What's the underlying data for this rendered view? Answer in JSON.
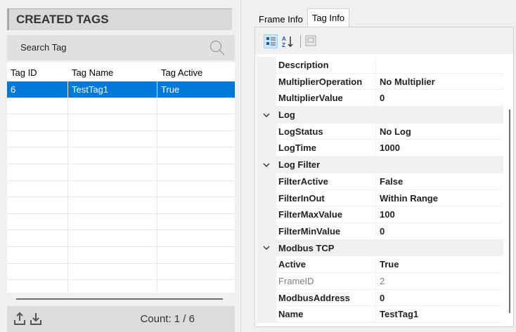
{
  "left": {
    "title": "CREATED TAGS",
    "search_placeholder": "Search Tag",
    "columns": [
      "Tag ID",
      "Tag Name",
      "Tag Active"
    ],
    "rows": [
      [
        "6",
        "TestTag1",
        "True"
      ],
      [
        "",
        "",
        ""
      ],
      [
        "",
        "",
        ""
      ],
      [
        "",
        "",
        ""
      ],
      [
        "",
        "",
        ""
      ],
      [
        "",
        "",
        ""
      ],
      [
        "",
        "",
        ""
      ],
      [
        "",
        "",
        ""
      ],
      [
        "",
        "",
        ""
      ],
      [
        "",
        "",
        ""
      ],
      [
        "",
        "",
        ""
      ],
      [
        "",
        "",
        ""
      ],
      [
        "",
        "",
        ""
      ]
    ],
    "count": "Count: 1 / 6",
    "icons": [
      "upload-icon",
      "download-icon",
      "search-icon"
    ]
  },
  "right": {
    "tabs": [
      "Frame Info",
      "Tag Info"
    ],
    "active_tab": "Tag Info",
    "toolbar": [
      "categorized-icon",
      "alphabetical-sort-icon",
      "property-pages-icon"
    ],
    "properties": [
      {
        "type": "prop",
        "name": "Description",
        "value": ""
      },
      {
        "type": "prop",
        "name": "MultiplierOperation",
        "value": "No Multiplier"
      },
      {
        "type": "prop",
        "name": "MultiplierValue",
        "value": "0"
      },
      {
        "type": "cat",
        "name": "Log"
      },
      {
        "type": "prop",
        "name": "LogStatus",
        "value": "No Log"
      },
      {
        "type": "prop",
        "name": "LogTime",
        "value": "1000"
      },
      {
        "type": "cat",
        "name": "Log Filter"
      },
      {
        "type": "prop",
        "name": "FilterActive",
        "value": "False"
      },
      {
        "type": "prop",
        "name": "FilterInOut",
        "value": "Within Range"
      },
      {
        "type": "prop",
        "name": "FilterMaxValue",
        "value": "100"
      },
      {
        "type": "prop",
        "name": "FilterMinValue",
        "value": "0"
      },
      {
        "type": "cat",
        "name": "Modbus TCP"
      },
      {
        "type": "prop",
        "name": "Active",
        "value": "True"
      },
      {
        "type": "readonly",
        "name": "FrameID",
        "value": "2"
      },
      {
        "type": "prop",
        "name": "ModbusAddress",
        "value": "0"
      },
      {
        "type": "prop",
        "name": "Name",
        "value": "TestTag1"
      }
    ]
  },
  "colors": {
    "selection": "#0078d7",
    "panel_bg": "#f0f0f0",
    "header_bg": "#d9d9d9"
  }
}
